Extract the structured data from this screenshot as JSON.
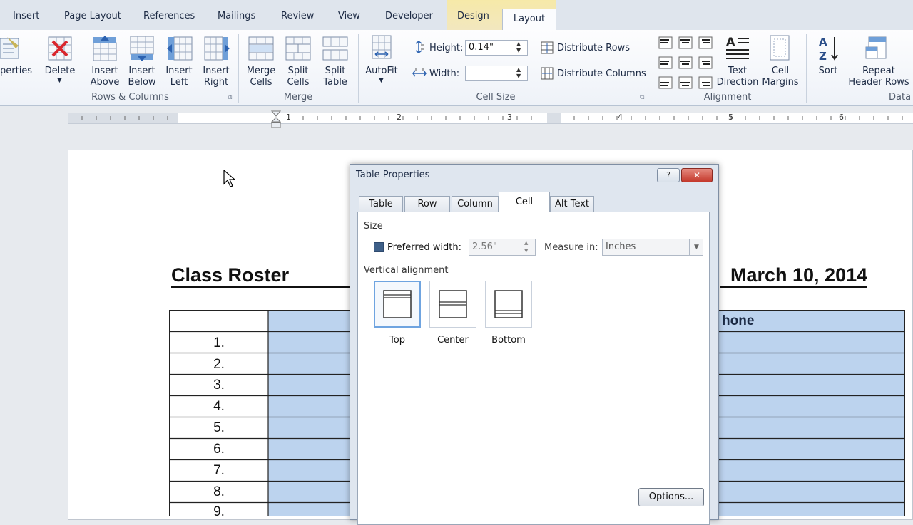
{
  "ribbon_tabs": [
    "Insert",
    "Page Layout",
    "References",
    "Mailings",
    "Review",
    "View",
    "Developer",
    "Design",
    "Layout"
  ],
  "ribbon": {
    "properties_label": "perties",
    "delete_label": "Delete",
    "insert_above": [
      "Insert",
      "Above"
    ],
    "insert_below": [
      "Insert",
      "Below"
    ],
    "insert_left": [
      "Insert",
      "Left"
    ],
    "insert_right": [
      "Insert",
      "Right"
    ],
    "merge_cells": [
      "Merge",
      "Cells"
    ],
    "split_cells": [
      "Split",
      "Cells"
    ],
    "split_table": [
      "Split",
      "Table"
    ],
    "autofit": "AutoFit",
    "height_label": "Height:",
    "height_value": "0.14\"",
    "width_label": "Width:",
    "width_value": "",
    "distribute_rows": "Distribute Rows",
    "distribute_columns": "Distribute Columns",
    "text_direction": [
      "Text",
      "Direction"
    ],
    "cell_margins": [
      "Cell",
      "Margins"
    ],
    "sort": "Sort",
    "repeat_header": [
      "Repeat",
      "Header Rows"
    ],
    "groups": {
      "rows_columns": "Rows & Columns",
      "merge": "Merge",
      "cell_size": "Cell Size",
      "alignment": "Alignment",
      "data": "Data"
    }
  },
  "ruler_numbers": [
    "1",
    "2",
    "3",
    "4",
    "5",
    "6"
  ],
  "document": {
    "title": "Class Roster",
    "date": "March 10, 2014",
    "header_partial": "hone",
    "rows": [
      "1.",
      "2.",
      "3.",
      "4.",
      "5.",
      "6.",
      "7.",
      "8.",
      "9."
    ]
  },
  "dialog": {
    "title": "Table Properties",
    "tabs": [
      "Table",
      "Row",
      "Column",
      "Cell",
      "Alt Text"
    ],
    "active_tab": "Cell",
    "size_label": "Size",
    "preferred_width_label": "Preferred width:",
    "preferred_width_value": "2.56\"",
    "measure_in_label": "Measure in:",
    "measure_in_value": "Inches",
    "vertical_alignment_label": "Vertical alignment",
    "alignment_options": [
      "Top",
      "Center",
      "Bottom"
    ],
    "options_button": "Options..."
  },
  "colors": {
    "cell_blue": "#bcd3ee",
    "accent": "#3c7fd0"
  }
}
